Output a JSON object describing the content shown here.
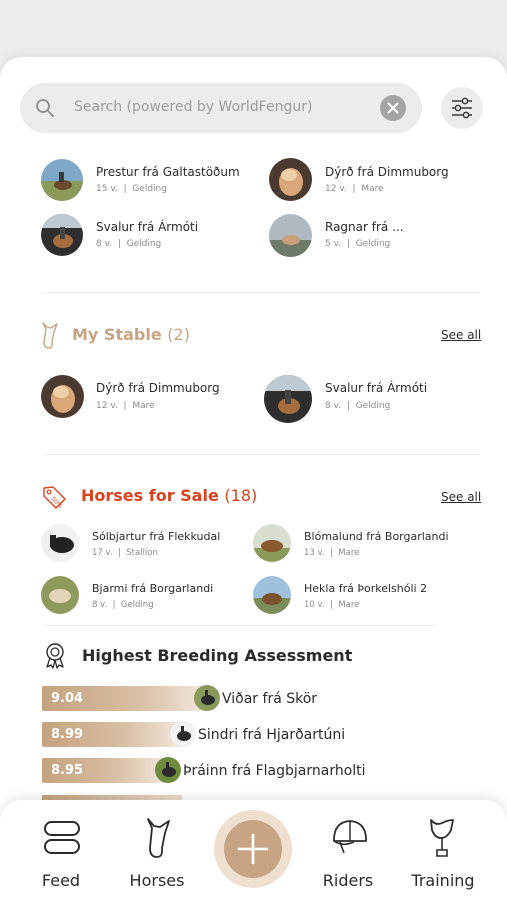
{
  "search": {
    "placeholder": "Search (powered by WorldFengur)"
  },
  "recent": [
    {
      "name": "Prestur frá Galtastöðum",
      "age": "15 v.",
      "sep": "|",
      "type": "Gelding"
    },
    {
      "name": "Dýrð frá Dimmuborg",
      "age": "12 v.",
      "sep": "|",
      "type": "Mare"
    },
    {
      "name": "Svalur frá Ármóti",
      "age": "8 v.",
      "sep": "|",
      "type": "Gelding"
    },
    {
      "name": "Ragnar frá ...",
      "age": "5 v.",
      "sep": "|",
      "type": "Gelding"
    }
  ],
  "stable": {
    "title": "My Stable",
    "count": "(2)",
    "see_all": "See all",
    "items": [
      {
        "name": "Dýrð frá Dimmuborg",
        "age": "12 v.",
        "sep": "|",
        "type": "Mare"
      },
      {
        "name": "Svalur frá Ármóti",
        "age": "8 v.",
        "sep": "|",
        "type": "Gelding"
      }
    ]
  },
  "sale": {
    "title": "Horses for Sale",
    "count": "(18)",
    "see_all": "See all",
    "items": [
      {
        "name": "Sólbjartur frá Flekkudal",
        "age": "17 v.",
        "sep": "|",
        "type": "Stallion"
      },
      {
        "name": "Blómalund frá Borgarlandi",
        "age": "13 v.",
        "sep": "|",
        "type": "Mare"
      },
      {
        "name": "Bjarmi frá Borgarlandi",
        "age": "8 v.",
        "sep": "|",
        "type": "Gelding"
      },
      {
        "name": "Hekla frá Þorkelshóli 2",
        "age": "10 v.",
        "sep": "|",
        "type": "Mare"
      }
    ]
  },
  "breeding": {
    "title": "Highest Breeding Assessment",
    "rows": [
      {
        "score": "9.04",
        "name": "Viðar frá Skör",
        "fraction": 0.9
      },
      {
        "score": "8.99",
        "name": "Sindri frá Hjarðartúni",
        "fraction": 0.77
      },
      {
        "score": "8.95",
        "name": "Þráinn frá Flagbjarnarholti",
        "fraction": 0.69
      }
    ]
  },
  "tabs": {
    "feed": "Feed",
    "horses": "Horses",
    "riders": "Riders",
    "training": "Training"
  },
  "colors": {
    "accent_gold": "#c7a584",
    "sale_red": "#d9431e",
    "text": "#2b2b2b",
    "muted": "#8b8b8b"
  }
}
